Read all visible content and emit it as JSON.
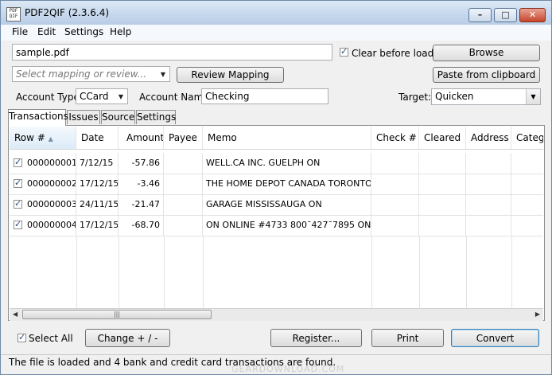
{
  "window": {
    "title": "PDF2QIF (2.3.6.4)",
    "app_icon_text": "PDF QIF",
    "minimize_symbol": "–",
    "maximize_symbol": "□",
    "close_symbol": "✕"
  },
  "menu": [
    "File",
    "Edit",
    "Settings",
    "Help"
  ],
  "file": {
    "value": "sample.pdf",
    "browse_label": "Browse",
    "clear_before_load_label": "Clear before load",
    "clear_before_load_checked": true
  },
  "mapping": {
    "placeholder": "Select mapping or review...",
    "review_label": "Review Mapping",
    "paste_label": "Paste from clipboard"
  },
  "account": {
    "type_label": "Account Type:",
    "type_value": "CCard",
    "name_label": "Account Name:",
    "name_value": "Checking",
    "target_label": "Target:",
    "target_value": "Quicken"
  },
  "tabs": [
    "Transactions",
    "Issues",
    "Source",
    "Settings"
  ],
  "grid": {
    "columns": [
      "Row #",
      "Date",
      "Amount",
      "Payee",
      "Memo",
      "Check #",
      "Cleared",
      "Address",
      "Catego"
    ],
    "sort_indicator": "▲",
    "rows": [
      {
        "checked": true,
        "row": "000000001",
        "date": "7/12/15",
        "amount": "-57.86",
        "payee": "",
        "memo": "WELL.CA INC. GUELPH ON"
      },
      {
        "checked": true,
        "row": "000000002",
        "date": "17/12/15",
        "amount": "-3.46",
        "payee": "",
        "memo": "THE HOME DEPOT CANADA TORONTO ON"
      },
      {
        "checked": true,
        "row": "000000003",
        "date": "24/11/15",
        "amount": "-21.47",
        "payee": "",
        "memo": "GARAGE MISSISSAUGA ON"
      },
      {
        "checked": true,
        "row": "000000004",
        "date": "17/12/15",
        "amount": "-68.70",
        "payee": "",
        "memo": "ON ONLINE #4733 800¯427¯7895 ON"
      }
    ]
  },
  "bottom": {
    "select_all_label": "Select All",
    "select_all_checked": true,
    "change_label": "Change + / -",
    "register_label": "Register...",
    "print_label": "Print",
    "convert_label": "Convert"
  },
  "status": "The file is loaded and 4 bank and credit card transactions are found.",
  "watermark": "GEARDOWNLOAD.COM"
}
